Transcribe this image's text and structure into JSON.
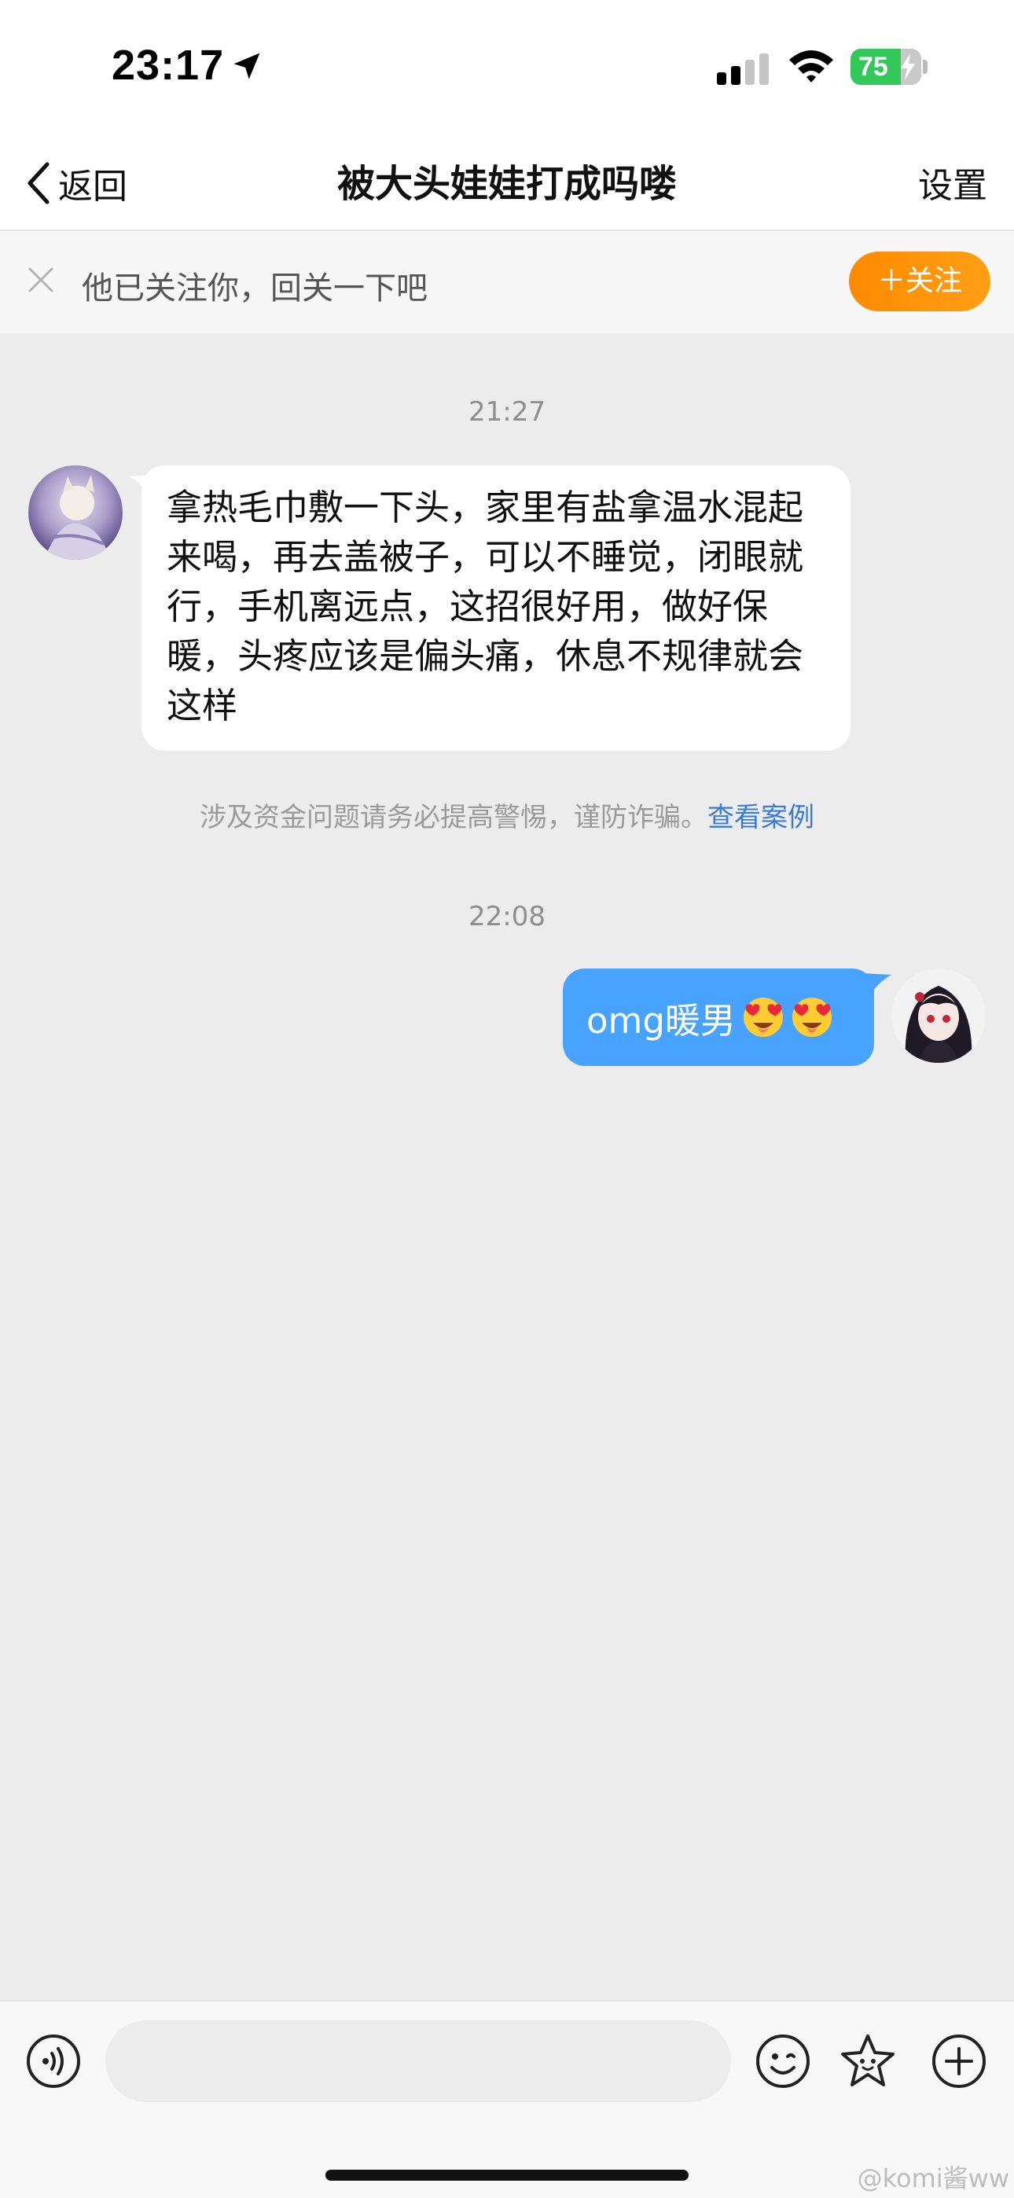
{
  "status_bar": {
    "time": "23:17",
    "battery": "75"
  },
  "nav": {
    "back_label": "返回",
    "title": "被大头娃娃打成吗喽",
    "settings_label": "设置"
  },
  "follow_banner": {
    "text": "他已关注你，回关一下吧",
    "button_label": "＋关注"
  },
  "messages": [
    {
      "timestamp": "21:27",
      "direction": "incoming",
      "text": "拿热毛巾敷一下头，家里有盐拿温水混起来喝，再去盖被子，可以不睡觉，闭眼就行，手机离远点，这招很好用，做好保暖，头疼应该是偏头痛，休息不规律就会这样"
    },
    {
      "timestamp": "22:08",
      "direction": "outgoing",
      "text": "omg暖男"
    }
  ],
  "warning": {
    "text": "涉及资金问题请务必提高警惕，谨防诈骗。",
    "link": "查看案例"
  },
  "input": {
    "placeholder": ""
  },
  "watermark": "@komi酱ww",
  "colors": {
    "outgoing_bubble": "#47a3ff",
    "follow_button": "#ff8a00",
    "link": "#3b7bd8",
    "battery": "#34c759"
  }
}
